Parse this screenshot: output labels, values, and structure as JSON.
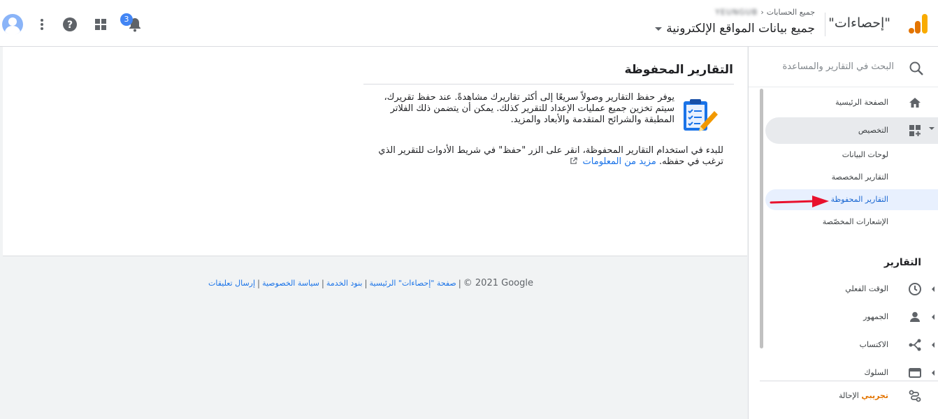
{
  "header": {
    "product_name": "\"إحصاءات\"",
    "breadcrumb_all_accounts": "جميع الحسابات",
    "breadcrumb_account": "YEUNGUB",
    "view_name": "جميع بيانات المواقع الإلكترونية",
    "notification_count": "3",
    "icons": [
      "avatar-icon",
      "more-vert-icon",
      "help-icon",
      "apps-icon",
      "bell-icon",
      "analytics-logo"
    ]
  },
  "main": {
    "title": "التقارير المحفوظة",
    "description": "يوفر حفظ التقارير وصولاً سريعًا إلى أكثر تقاريرك مشاهدةً. عند حفظ تقريرك، سيتم تخزين جميع عمليات الإعداد للتقرير كذلك. يمكن أن يتضمن ذلك الفلاتر المطبقة والشرائح المتقدمة والأبعاد والمزيد.",
    "howto": "للبدء في استخدام التقارير المحفوظة، انقر على الزر \"حفظ\" في شريط الأدوات للتقرير الذي ترغب في حفظه.",
    "learn_more": "مزيد من المعلومات"
  },
  "footer": {
    "copyright": "© 2021 Google",
    "home": "صفحة \"إحصاءات\" الرئيسية",
    "terms": "بنود الخدمة",
    "privacy": "سياسة الخصوصية",
    "feedback": "إرسال تعليقات",
    "sep": "|"
  },
  "sidebar": {
    "search_placeholder": "البحث في التقارير والمساعدة",
    "home": "الصفحة الرئيسية",
    "customization": "التخصيص",
    "sub_items": [
      "لوحات البيانات",
      "التقارير المخصصة",
      "التقارير المحفوظة",
      "الإشعارات المخصّصة"
    ],
    "reports_section": "التقارير",
    "realtime": "الوقت الفعلي",
    "audience": "الجمهور",
    "acquisition": "الاكتساب",
    "behavior": "السلوك",
    "attribution": "الإحالة",
    "beta": "تجريبي"
  },
  "colors": {
    "accent": "#1a73e8",
    "selected_bg": "#e8f0fe",
    "annotation_arrow": "#e8112d",
    "beta": "#e37400"
  }
}
